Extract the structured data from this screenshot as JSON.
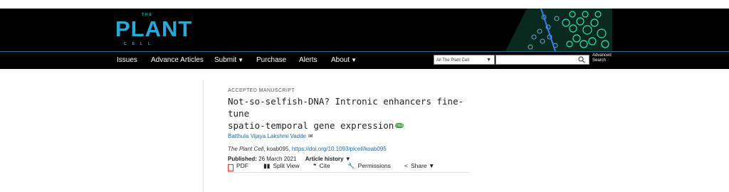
{
  "header": {
    "logo": {
      "the": "THE",
      "plant": "PLANT",
      "cell": "CELL"
    },
    "nav": [
      {
        "label": "Issues",
        "caret": false
      },
      {
        "label": "Advance Articles",
        "caret": false
      },
      {
        "label": "Submit",
        "caret": true
      },
      {
        "label": "Purchase",
        "caret": false
      },
      {
        "label": "Alerts",
        "caret": false
      },
      {
        "label": "About",
        "caret": true
      }
    ],
    "search": {
      "scope": "All The Plant Cell",
      "placeholder": "",
      "advanced_line1": "Advanced",
      "advanced_line2": "Search"
    }
  },
  "article": {
    "type_label": "ACCEPTED MANUSCRIPT",
    "title_line1": "Not-so-selfish-DNA? Intronic enhancers fine-tune",
    "title_line2": "spatio-temporal gene expression",
    "free_badge": "FREE",
    "author": "Batthula Vijaya Lakshmi Vadde",
    "journal": "The Plant Cell",
    "article_id": ", koab095, ",
    "doi": "https://doi.org/10.1093/plcell/koab095",
    "published_label": "Published:",
    "published_date": "26 March 2021",
    "history_label": "Article history"
  },
  "toolbar": {
    "pdf": "PDF",
    "split_view": "Split View",
    "cite": "Cite",
    "permissions": "Permissions",
    "share": "Share"
  },
  "colors": {
    "brand_blue": "#29a9d6",
    "link_blue": "#1f6aa8",
    "free_green": "#3aa34a",
    "header_bg": "#000000"
  },
  "icons": [
    "search-icon",
    "mail-icon",
    "pdf-icon",
    "split-view-icon",
    "cite-icon",
    "permissions-icon",
    "share-icon",
    "chevron-down-icon"
  ]
}
